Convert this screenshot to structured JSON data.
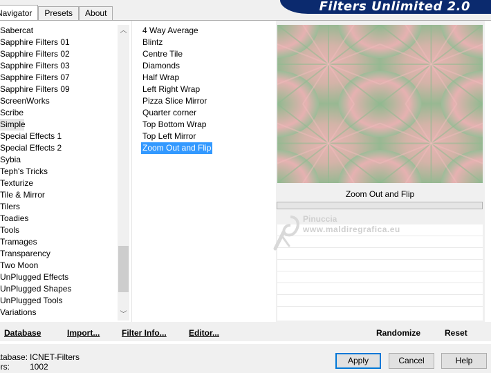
{
  "window": {
    "title": "Filters Unlimited 2.0"
  },
  "tabs": [
    {
      "label": "Navigator"
    },
    {
      "label": "Presets"
    },
    {
      "label": "About"
    }
  ],
  "categories": [
    "Sabercat",
    "Sapphire Filters 01",
    "Sapphire Filters 02",
    "Sapphire Filters 03",
    "Sapphire Filters 07",
    "Sapphire Filters 09",
    "ScreenWorks",
    "Scribe",
    "Simple",
    "Special Effects 1",
    "Special Effects 2",
    "Sybia",
    "Teph's Tricks",
    "Texturize",
    "Tile & Mirror",
    "Tilers",
    "Toadies",
    "Tools",
    "Tramages",
    "Transparency",
    "Two Moon",
    "UnPlugged Effects",
    "UnPlugged Shapes",
    "UnPlugged Tools",
    "Variations"
  ],
  "selected_category": "Simple",
  "filters": [
    "4 Way Average",
    "Blintz",
    "Centre Tile",
    "Diamonds",
    "Half Wrap",
    "Left Right Wrap",
    "Pizza Slice Mirror",
    "Quarter corner",
    "Top Bottom Wrap",
    "Top Left Mirror",
    "Zoom Out and Flip"
  ],
  "selected_filter": "Zoom Out and Flip",
  "preview": {
    "label": "Zoom Out and Flip",
    "colors": {
      "pink": "#e6b1b1",
      "green": "#8fb98f",
      "mid": "#c8b7a8"
    }
  },
  "watermark": {
    "line1": "Pinuccia",
    "line2": "www.maldiregrafica.eu"
  },
  "toolbar": {
    "database": "Database",
    "import": "Import...",
    "filter_info": "Filter Info...",
    "editor": "Editor...",
    "randomize": "Randomize",
    "reset": "Reset"
  },
  "info": {
    "database_label": "atabase:",
    "database_value": "ICNET-Filters",
    "filters_label": "ers:",
    "filters_value": "1002"
  },
  "buttons": {
    "apply": "Apply",
    "cancel": "Cancel",
    "help": "Help"
  },
  "scroll": {
    "up_glyph": "︿",
    "down_glyph": "﹀"
  }
}
